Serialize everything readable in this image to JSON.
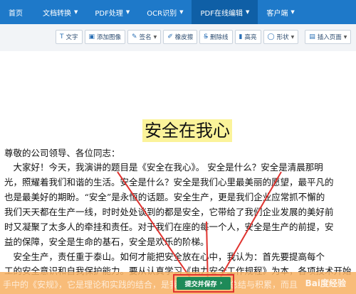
{
  "nav": {
    "items": [
      {
        "label": "首页",
        "caret": ""
      },
      {
        "label": "文档转换",
        "caret": "▼"
      },
      {
        "label": "PDF处理",
        "caret": "▼"
      },
      {
        "label": "OCR识别",
        "caret": "▼"
      },
      {
        "label": "PDF在线编辑",
        "caret": "▼"
      },
      {
        "label": "客户端",
        "caret": "▼"
      }
    ],
    "active_index": 4,
    "colors": {
      "bar": "#1e79c9",
      "active": "#0f5fa6"
    }
  },
  "toolbar": {
    "text_label": "文字",
    "add_image_label": "添加图像",
    "sign_label": "签名",
    "eraser_label": "橡皮擦",
    "strike_label": "删除线",
    "highlight_label": "高亮",
    "shape_label": "形状",
    "insert_page_label": "插入页面"
  },
  "document": {
    "title": "安全在我心",
    "lines": [
      "尊敬的公司领导、各位同志：",
      "　大家好！今天，我演讲的题目是《安全在我心》。 安全是什么？安全是清晨那明",
      "光，照耀着我们和谐的生活。安全是什么？安全是我们心里最美丽的愿望，最平凡的",
      "也是最美好的期盼。“安全”是永恒的话题。安全生产，更是我们企业应常抓不懈的",
      "我们天天都在生产一线，时时处处谈到的都是安全，它带给了我们企业发展的美好前",
      "时又凝聚了太多人的牵挂和责任。对于我们在座的每一个人，安全是生产的前提，安",
      "益的保障，安全是生命的基石，安全是欢乐的阶梯。",
      "　安全生产，责任重于泰山。如何才能把安全放在心中，我认为：首先要提高每个",
      "工的安全意识和自我保护能力。要从认真学习《电力安全工作规程》为本，各项技术开始"
    ]
  },
  "banner": {
    "faded_text": "手中的《安规》，它是理论和实践的结合，是我们长期的经验总结与积累，而且",
    "watermark": "Bai度经验"
  },
  "submit": {
    "label": "提交并保存",
    "icon": "chevron-right-icon"
  }
}
